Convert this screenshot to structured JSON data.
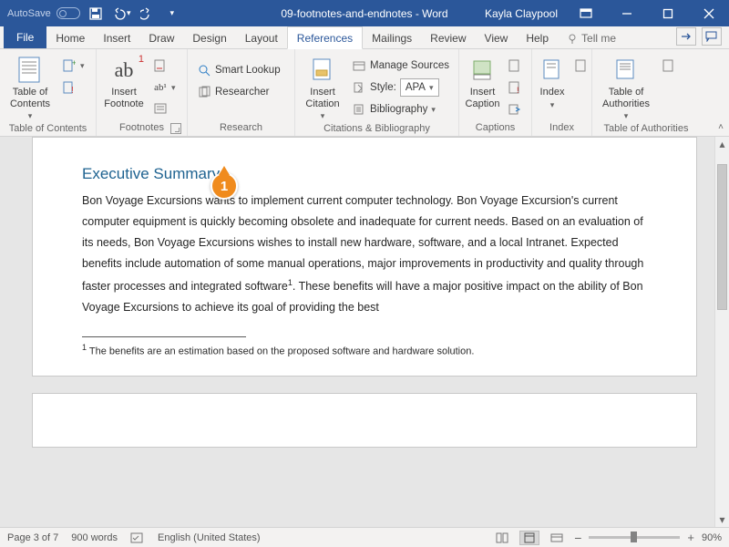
{
  "titlebar": {
    "autosave_label": "AutoSave",
    "autosave_state": "Off",
    "doc_title": "09-footnotes-and-endnotes - Word",
    "user": "Kayla Claypool"
  },
  "tabs": {
    "file": "File",
    "list": [
      "Home",
      "Insert",
      "Draw",
      "Design",
      "Layout",
      "References",
      "Mailings",
      "Review",
      "View",
      "Help"
    ],
    "active": "References",
    "tellme": "Tell me"
  },
  "ribbon": {
    "toc": {
      "big": "Table of\nContents",
      "label": "Table of Contents"
    },
    "footnotes": {
      "big": "Insert\nFootnote",
      "ab_label": "ab",
      "ab1_label": "ab¹",
      "label": "Footnotes"
    },
    "research": {
      "smart": "Smart Lookup",
      "researcher": "Researcher",
      "label": "Research"
    },
    "cit": {
      "big": "Insert\nCitation",
      "manage": "Manage Sources",
      "style_label": "Style:",
      "style_value": "APA",
      "bib": "Bibliography",
      "label": "Citations & Bibliography"
    },
    "captions": {
      "big": "Insert\nCaption",
      "label": "Captions"
    },
    "index": {
      "big": "Index",
      "label": "Index"
    },
    "toa": {
      "big": "Table of\nAuthorities",
      "label": "Table of Authorities"
    }
  },
  "document": {
    "heading": "Executive Summary",
    "body_a": "Bon Voyage Excursions wants to implement current computer technology. Bon Voyage Excursion's current computer equipment is quickly becoming obsolete and inadequate for current needs. Based on an evaluation of its needs, Bon Voyage Excursions wishes to install new hardware, software, and a local Intranet. Expected benefits include automation of some manual operations, major improvements in productivity and quality through faster processes and integrated software",
    "sup": "1",
    "body_b": ". These benefits will have a major positive impact on the ability of Bon Voyage Excursions to achieve its goal of providing the best",
    "footnote_num": "1",
    "footnote_text": " The benefits are an estimation based on the proposed software and hardware solution."
  },
  "callouts": {
    "one": "1"
  },
  "status": {
    "page": "Page 3 of 7",
    "words": "900 words",
    "lang": "English (United States)",
    "zoom": "90%"
  }
}
